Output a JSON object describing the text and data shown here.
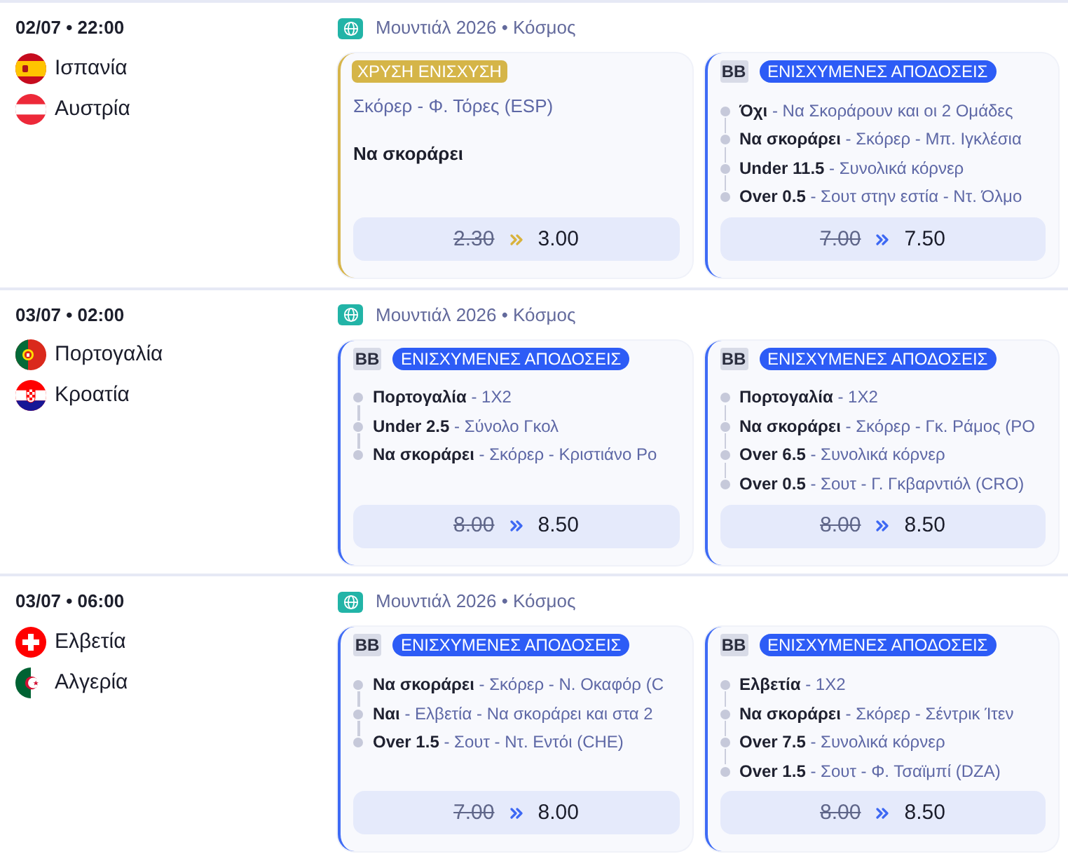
{
  "matches": [
    {
      "datetime": "02/07 • 22:00",
      "teams": [
        {
          "name": "Ισπανία",
          "kind": "spain"
        },
        {
          "name": "Αυστρία",
          "kind": "austria"
        }
      ],
      "league": "Μουντιάλ 2026 • Κόσμος",
      "offers": [
        {
          "kind": "gold",
          "badge": "ΧΡΥΣΗ ΕΝΙΣΧΥΣΗ",
          "market": "Σκόρερ - Φ. Τόρες (ESP)",
          "pick": "Να σκοράρει",
          "old_odds": "2.30",
          "new_odds": "3.00"
        },
        {
          "kind": "builder",
          "tag": "BB",
          "badge": "ΕΝΙΣΧΥΜΕΝΕΣ ΑΠΟΔΟΣΕΙΣ",
          "selections": [
            "**Όχι** - Να Σκοράρουν και οι 2 Ομάδες",
            "**Να σκοράρει** - Σκόρερ - Μπ. Ιγκλέσια",
            "**Under 11.5** - Συνολικά κόρνερ",
            "**Over 0.5** - Σουτ στην εστία - Ντ. Όλμο"
          ],
          "old_odds": "7.00",
          "new_odds": "7.50"
        }
      ]
    },
    {
      "datetime": "03/07 • 02:00",
      "teams": [
        {
          "name": "Πορτογαλία",
          "kind": "portugal"
        },
        {
          "name": "Κροατία",
          "kind": "croatia"
        }
      ],
      "league": "Μουντιάλ 2026 • Κόσμος",
      "offers": [
        {
          "kind": "builder",
          "tag": "BB",
          "badge": "ΕΝΙΣΧΥΜΕΝΕΣ ΑΠΟΔΟΣΕΙΣ",
          "selections": [
            "**Πορτογαλία** - 1X2",
            "**Under 2.5** - Σύνολο Γκολ",
            "**Να σκοράρει** - Σκόρερ - Κριστιάνο Ρο"
          ],
          "old_odds": "8.00",
          "new_odds": "8.50"
        },
        {
          "kind": "builder",
          "tag": "BB",
          "badge": "ΕΝΙΣΧΥΜΕΝΕΣ ΑΠΟΔΟΣΕΙΣ",
          "selections": [
            "**Πορτογαλία** - 1X2",
            "**Να σκοράρει** - Σκόρερ - Γκ. Ράμος (PO",
            "**Over 6.5** - Συνολικά κόρνερ",
            "**Over 0.5** - Σουτ - Γ. Γκβαρντιόλ (CRO)"
          ],
          "old_odds": "8.00",
          "new_odds": "8.50"
        }
      ]
    },
    {
      "datetime": "03/07 • 06:00",
      "teams": [
        {
          "name": "Ελβετία",
          "kind": "switzerland"
        },
        {
          "name": "Αλγερία",
          "kind": "algeria"
        }
      ],
      "league": "Μουντιάλ 2026 • Κόσμος",
      "offers": [
        {
          "kind": "builder",
          "tag": "BB",
          "badge": "ΕΝΙΣΧΥΜΕΝΕΣ ΑΠΟΔΟΣΕΙΣ",
          "selections": [
            "**Να σκοράρει** - Σκόρερ - Ν. Οκαφόρ (C",
            "**Ναι** - Ελβετία - Να σκοράρει και στα 2",
            "**Over 1.5** - Σουτ - Ντ. Εντόι (CHE)"
          ],
          "old_odds": "7.00",
          "new_odds": "8.00"
        },
        {
          "kind": "builder",
          "tag": "BB",
          "badge": "ΕΝΙΣΧΥΜΕΝΕΣ ΑΠΟΔΟΣΕΙΣ",
          "selections": [
            "**Ελβετία** - 1X2",
            "**Να σκοράρει** - Σκόρερ - Σέντρικ Ίτεν",
            "**Over 7.5** - Συνολικά κόρνερ",
            "**Over 1.5** - Σουτ - Φ. Τσαϊμπί (DZA)"
          ],
          "old_odds": "8.00",
          "new_odds": "8.50"
        }
      ]
    }
  ]
}
